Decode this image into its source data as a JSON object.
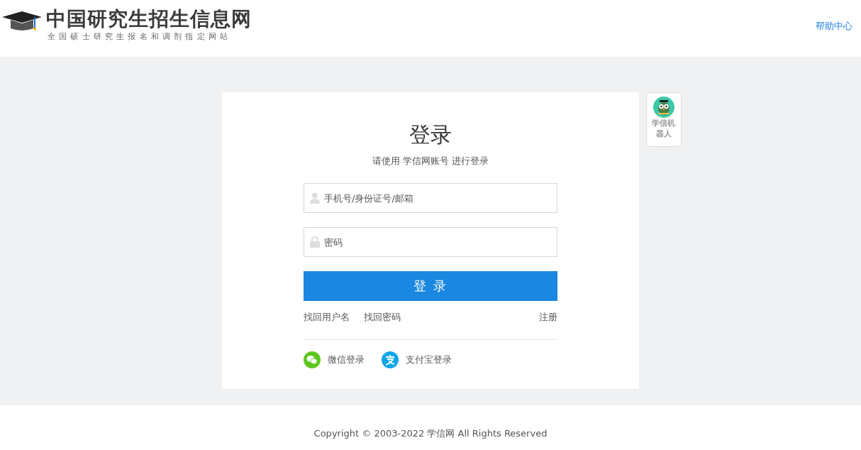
{
  "header": {
    "logo_title": "中国研究生招生信息网",
    "logo_subtitle": "全国硕士研究生报名和调剂指定网站",
    "help_link": "帮助中心"
  },
  "login": {
    "title": "登录",
    "subtitle": "请使用 学信网账号 进行登录",
    "fields": [
      {
        "kind": "user",
        "placeholder": "手机号/身份证号/邮箱"
      },
      {
        "kind": "password",
        "placeholder": "密码"
      }
    ],
    "submit": "登 录",
    "links": [
      "找回用户名",
      "找回密码"
    ],
    "register": "注册",
    "social": [
      {
        "kind": "wechat",
        "label": "微信登录"
      },
      {
        "kind": "alipay",
        "label": "支付宝登录"
      }
    ]
  },
  "robot": {
    "label": "学信机器人"
  },
  "footer": "Copyright © 2003-2022 学信网 All Rights Reserved"
}
